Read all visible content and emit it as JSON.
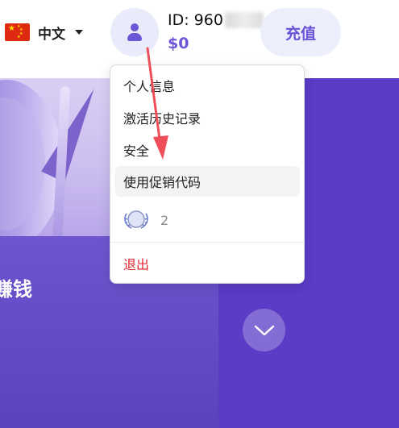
{
  "header": {
    "language": {
      "label": "中文",
      "flag": "china-flag"
    },
    "account": {
      "id_prefix": "ID: 960",
      "balance": "$0"
    },
    "recharge_label": "充值"
  },
  "banner": {
    "title": "赚钱"
  },
  "dropdown": {
    "items": [
      {
        "label": "个人信息"
      },
      {
        "label": "激活历史记录"
      },
      {
        "label": "安全"
      },
      {
        "label": "使用促销代码"
      }
    ],
    "badge_count": "2",
    "logout_label": "退出"
  },
  "colors": {
    "accent": "#6f55d8",
    "banner": "#5a3cc6",
    "logout": "#e0262e",
    "annotation_arrow": "#ee4e58"
  }
}
